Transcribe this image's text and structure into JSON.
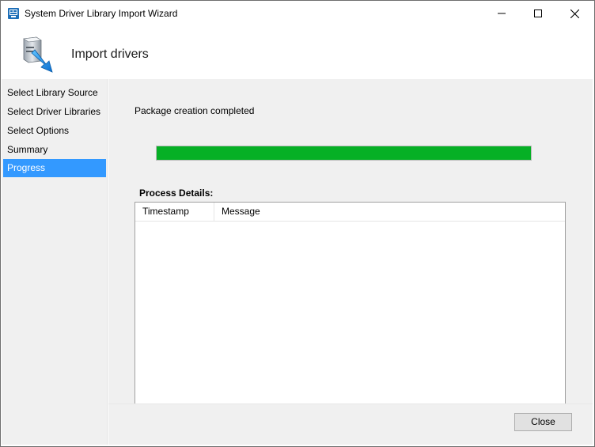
{
  "window": {
    "title": "System Driver Library Import Wizard"
  },
  "header": {
    "title": "Import drivers",
    "icon": "import-drivers-icon"
  },
  "nav": {
    "items": [
      {
        "label": "Select Library Source",
        "active": false
      },
      {
        "label": "Select Driver Libraries",
        "active": false
      },
      {
        "label": "Select Options",
        "active": false
      },
      {
        "label": "Summary",
        "active": false
      },
      {
        "label": "Progress",
        "active": true
      }
    ]
  },
  "progress": {
    "status": "Package creation completed",
    "percent": 100,
    "color": "#06b025"
  },
  "details": {
    "label": "Process Details:",
    "columns": [
      "Timestamp",
      "Message"
    ],
    "rows": []
  },
  "footer": {
    "close_label": "Close"
  },
  "colors": {
    "accent": "#3399ff",
    "progress_fill": "#06b025",
    "panel_bg": "#f0f0f0"
  }
}
